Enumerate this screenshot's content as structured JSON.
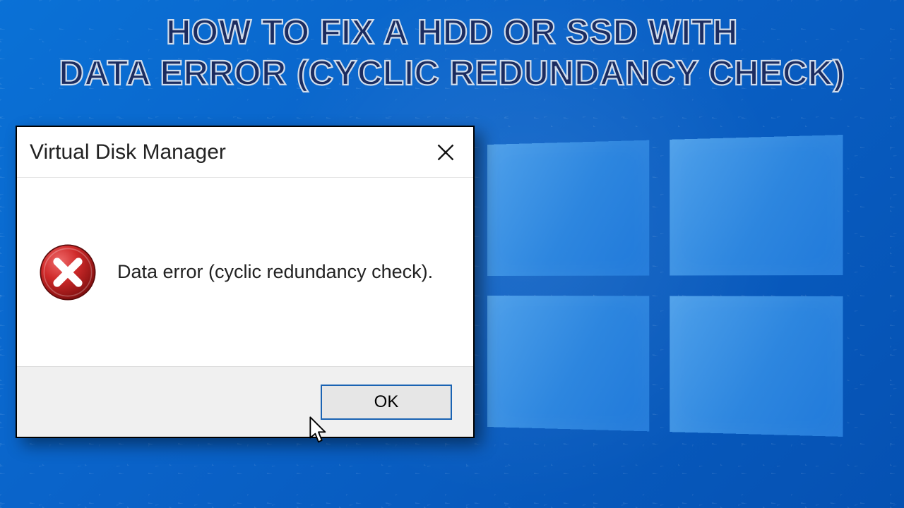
{
  "headline": {
    "line1": "HOW TO FIX A HDD OR SSD WITH",
    "line2": "DATA ERROR (CYCLIC REDUNDANCY CHECK)"
  },
  "dialog": {
    "title": "Virtual Disk Manager",
    "message": "Data error (cyclic redundancy check).",
    "ok_label": "OK",
    "close_icon": "close-icon",
    "error_icon": "error-x-icon"
  },
  "colors": {
    "wallpaper_base": "#0a6fd4",
    "headline_fill": "#1b2c60",
    "headline_stroke": "#d1ddec",
    "dialog_border": "#000000",
    "button_bar_bg": "#f0f0f0",
    "ok_border": "#1a63b3"
  }
}
